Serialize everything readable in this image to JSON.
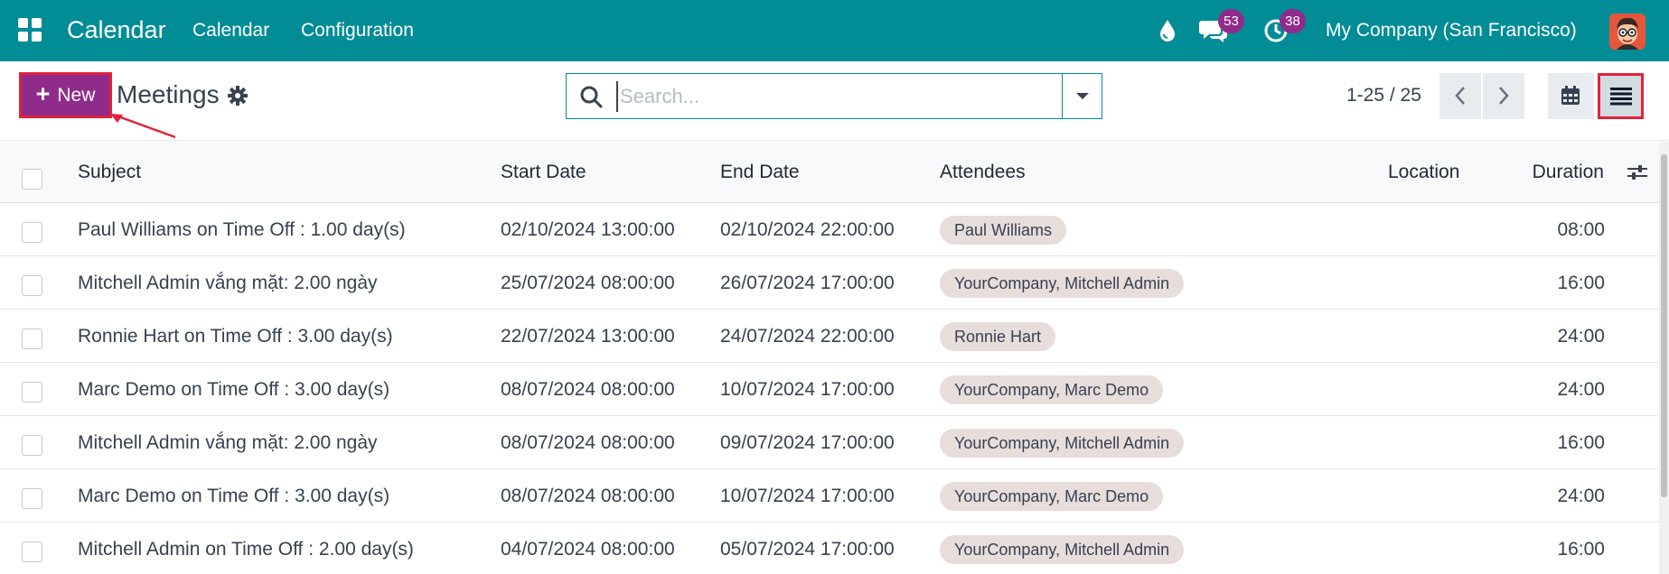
{
  "navbar": {
    "app_name": "Calendar",
    "menu": [
      "Calendar",
      "Configuration"
    ],
    "messages_count": "53",
    "activities_count": "38",
    "company": "My Company (San Francisco)"
  },
  "control_panel": {
    "new_label": "New",
    "title": "Meetings",
    "search_placeholder": "Search...",
    "pager_value": "1-25 / 25"
  },
  "table": {
    "headers": {
      "subject": "Subject",
      "start": "Start Date",
      "end": "End Date",
      "attendees": "Attendees",
      "location": "Location",
      "duration": "Duration"
    },
    "rows": [
      {
        "subject": "Paul Williams on Time Off : 1.00 day(s)",
        "start": "02/10/2024 13:00:00",
        "end": "02/10/2024 22:00:00",
        "attendees": "Paul Williams",
        "location": "",
        "duration": "08:00"
      },
      {
        "subject": "Mitchell Admin vắng mặt: 2.00 ngày",
        "start": "25/07/2024 08:00:00",
        "end": "26/07/2024 17:00:00",
        "attendees": "YourCompany, Mitchell Admin",
        "location": "",
        "duration": "16:00"
      },
      {
        "subject": "Ronnie Hart on Time Off : 3.00 day(s)",
        "start": "22/07/2024 13:00:00",
        "end": "24/07/2024 22:00:00",
        "attendees": "Ronnie Hart",
        "location": "",
        "duration": "24:00"
      },
      {
        "subject": "Marc Demo on Time Off : 3.00 day(s)",
        "start": "08/07/2024 08:00:00",
        "end": "10/07/2024 17:00:00",
        "attendees": "YourCompany, Marc Demo",
        "location": "",
        "duration": "24:00"
      },
      {
        "subject": "Mitchell Admin vắng mặt: 2.00 ngày",
        "start": "08/07/2024 08:00:00",
        "end": "09/07/2024 17:00:00",
        "attendees": "YourCompany, Mitchell Admin",
        "location": "",
        "duration": "16:00"
      },
      {
        "subject": "Marc Demo on Time Off : 3.00 day(s)",
        "start": "08/07/2024 08:00:00",
        "end": "10/07/2024 17:00:00",
        "attendees": "YourCompany, Marc Demo",
        "location": "",
        "duration": "24:00"
      },
      {
        "subject": "Mitchell Admin on Time Off : 2.00 day(s)",
        "start": "04/07/2024 08:00:00",
        "end": "05/07/2024 17:00:00",
        "attendees": "YourCompany, Mitchell Admin",
        "location": "",
        "duration": "16:00"
      }
    ]
  },
  "icons": {
    "apps": "apps-grid-icon",
    "droplet": "droplet-icon",
    "messages": "chat-icon",
    "activities": "clock-icon",
    "search": "search-icon",
    "settings": "gear-icon",
    "pager_prev": "chevron-left-icon",
    "pager_next": "chevron-right-icon",
    "calendar_view": "calendar-icon",
    "list_view": "list-icon",
    "column_options": "sliders-icon"
  },
  "colors": {
    "navbar": "#018c96",
    "primary": "#8f2c8b",
    "highlight": "#e1223a",
    "tag": "#e7dddb"
  }
}
